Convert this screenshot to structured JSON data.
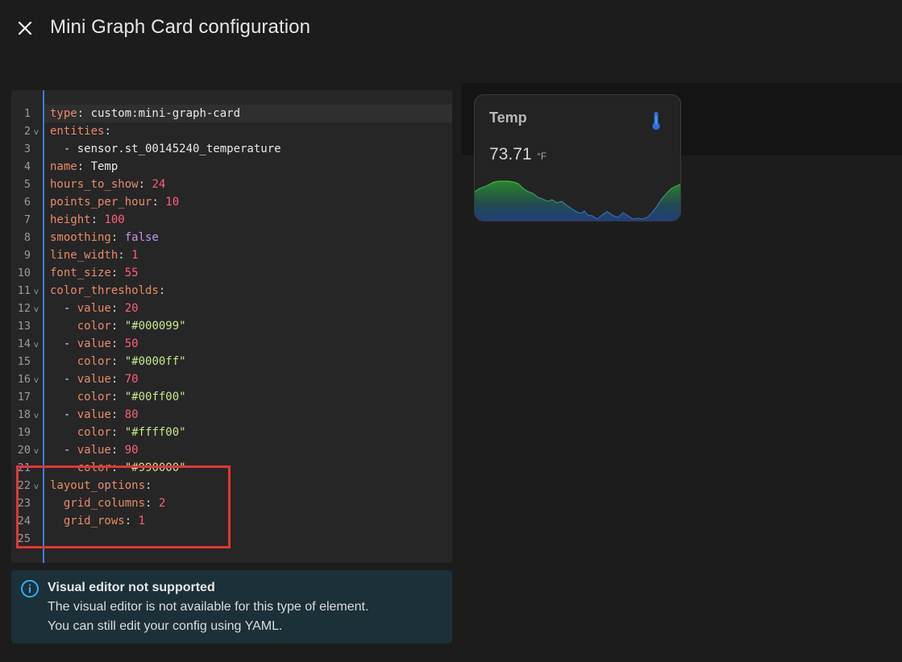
{
  "dialog": {
    "title": "Mini Graph Card configuration",
    "close_icon": "close-icon"
  },
  "editor": {
    "lines": [
      {
        "num": "1",
        "fold": false,
        "tokens": [
          {
            "c": "k",
            "t": "type"
          },
          {
            "c": "p",
            "t": ": "
          },
          {
            "c": "s",
            "t": "custom:mini-graph-card"
          }
        ]
      },
      {
        "num": "2",
        "fold": true,
        "tokens": [
          {
            "c": "k",
            "t": "entities"
          },
          {
            "c": "p",
            "t": ":"
          }
        ]
      },
      {
        "num": "3",
        "fold": false,
        "tokens": [
          {
            "c": "p",
            "t": "  - "
          },
          {
            "c": "s",
            "t": "sensor.st_00145240_temperature"
          }
        ]
      },
      {
        "num": "4",
        "fold": false,
        "tokens": [
          {
            "c": "k",
            "t": "name"
          },
          {
            "c": "p",
            "t": ": "
          },
          {
            "c": "s",
            "t": "Temp"
          }
        ]
      },
      {
        "num": "5",
        "fold": false,
        "tokens": [
          {
            "c": "k",
            "t": "hours_to_show"
          },
          {
            "c": "p",
            "t": ": "
          },
          {
            "c": "n",
            "t": "24"
          }
        ]
      },
      {
        "num": "6",
        "fold": false,
        "tokens": [
          {
            "c": "k",
            "t": "points_per_hour"
          },
          {
            "c": "p",
            "t": ": "
          },
          {
            "c": "n",
            "t": "10"
          }
        ]
      },
      {
        "num": "7",
        "fold": false,
        "tokens": [
          {
            "c": "k",
            "t": "height"
          },
          {
            "c": "p",
            "t": ": "
          },
          {
            "c": "n",
            "t": "100"
          }
        ]
      },
      {
        "num": "8",
        "fold": false,
        "tokens": [
          {
            "c": "k",
            "t": "smoothing"
          },
          {
            "c": "p",
            "t": ": "
          },
          {
            "c": "b",
            "t": "false"
          }
        ]
      },
      {
        "num": "9",
        "fold": false,
        "tokens": [
          {
            "c": "k",
            "t": "line_width"
          },
          {
            "c": "p",
            "t": ": "
          },
          {
            "c": "n",
            "t": "1"
          }
        ]
      },
      {
        "num": "10",
        "fold": false,
        "tokens": [
          {
            "c": "k",
            "t": "font_size"
          },
          {
            "c": "p",
            "t": ": "
          },
          {
            "c": "n",
            "t": "55"
          }
        ]
      },
      {
        "num": "11",
        "fold": true,
        "tokens": [
          {
            "c": "k",
            "t": "color_thresholds"
          },
          {
            "c": "p",
            "t": ":"
          }
        ]
      },
      {
        "num": "12",
        "fold": true,
        "tokens": [
          {
            "c": "p",
            "t": "  - "
          },
          {
            "c": "k",
            "t": "value"
          },
          {
            "c": "p",
            "t": ": "
          },
          {
            "c": "n",
            "t": "20"
          }
        ]
      },
      {
        "num": "13",
        "fold": false,
        "tokens": [
          {
            "c": "p",
            "t": "    "
          },
          {
            "c": "k",
            "t": "color"
          },
          {
            "c": "p",
            "t": ": "
          },
          {
            "c": "q",
            "t": "\"#000099\""
          }
        ]
      },
      {
        "num": "14",
        "fold": true,
        "tokens": [
          {
            "c": "p",
            "t": "  - "
          },
          {
            "c": "k",
            "t": "value"
          },
          {
            "c": "p",
            "t": ": "
          },
          {
            "c": "n",
            "t": "50"
          }
        ]
      },
      {
        "num": "15",
        "fold": false,
        "tokens": [
          {
            "c": "p",
            "t": "    "
          },
          {
            "c": "k",
            "t": "color"
          },
          {
            "c": "p",
            "t": ": "
          },
          {
            "c": "q",
            "t": "\"#0000ff\""
          }
        ]
      },
      {
        "num": "16",
        "fold": true,
        "tokens": [
          {
            "c": "p",
            "t": "  - "
          },
          {
            "c": "k",
            "t": "value"
          },
          {
            "c": "p",
            "t": ": "
          },
          {
            "c": "n",
            "t": "70"
          }
        ]
      },
      {
        "num": "17",
        "fold": false,
        "tokens": [
          {
            "c": "p",
            "t": "    "
          },
          {
            "c": "k",
            "t": "color"
          },
          {
            "c": "p",
            "t": ": "
          },
          {
            "c": "q",
            "t": "\"#00ff00\""
          }
        ]
      },
      {
        "num": "18",
        "fold": true,
        "tokens": [
          {
            "c": "p",
            "t": "  - "
          },
          {
            "c": "k",
            "t": "value"
          },
          {
            "c": "p",
            "t": ": "
          },
          {
            "c": "n",
            "t": "80"
          }
        ]
      },
      {
        "num": "19",
        "fold": false,
        "tokens": [
          {
            "c": "p",
            "t": "    "
          },
          {
            "c": "k",
            "t": "color"
          },
          {
            "c": "p",
            "t": ": "
          },
          {
            "c": "q",
            "t": "\"#ffff00\""
          }
        ]
      },
      {
        "num": "20",
        "fold": true,
        "tokens": [
          {
            "c": "p",
            "t": "  - "
          },
          {
            "c": "k",
            "t": "value"
          },
          {
            "c": "p",
            "t": ": "
          },
          {
            "c": "n",
            "t": "90"
          }
        ]
      },
      {
        "num": "21",
        "fold": false,
        "tokens": [
          {
            "c": "p",
            "t": "    "
          },
          {
            "c": "k",
            "t": "color"
          },
          {
            "c": "p",
            "t": ": "
          },
          {
            "c": "q",
            "t": "\"#990000\""
          }
        ]
      },
      {
        "num": "22",
        "fold": true,
        "tokens": [
          {
            "c": "k",
            "t": "layout_options"
          },
          {
            "c": "p",
            "t": ":"
          }
        ]
      },
      {
        "num": "23",
        "fold": false,
        "tokens": [
          {
            "c": "p",
            "t": "  "
          },
          {
            "c": "k",
            "t": "grid_columns"
          },
          {
            "c": "p",
            "t": ": "
          },
          {
            "c": "n",
            "t": "2"
          }
        ]
      },
      {
        "num": "24",
        "fold": false,
        "tokens": [
          {
            "c": "p",
            "t": "  "
          },
          {
            "c": "k",
            "t": "grid_rows"
          },
          {
            "c": "p",
            "t": ": "
          },
          {
            "c": "n",
            "t": "1"
          }
        ]
      },
      {
        "num": "25",
        "fold": false,
        "tokens": []
      }
    ]
  },
  "alert": {
    "icon": "info-icon",
    "title": "Visual editor not supported",
    "message_line1": "The visual editor is not available for this type of element.",
    "message_line2": "You can still edit your config using YAML."
  },
  "preview": {
    "card": {
      "name": "Temp",
      "icon": "thermometer-icon",
      "icon_color": "#2e6fd9",
      "value": "73.71",
      "unit": "°F",
      "graph_colors": [
        "#2a8a2a",
        "#1f3f86"
      ]
    }
  },
  "annotation": {
    "highlight_color": "#e33539"
  }
}
